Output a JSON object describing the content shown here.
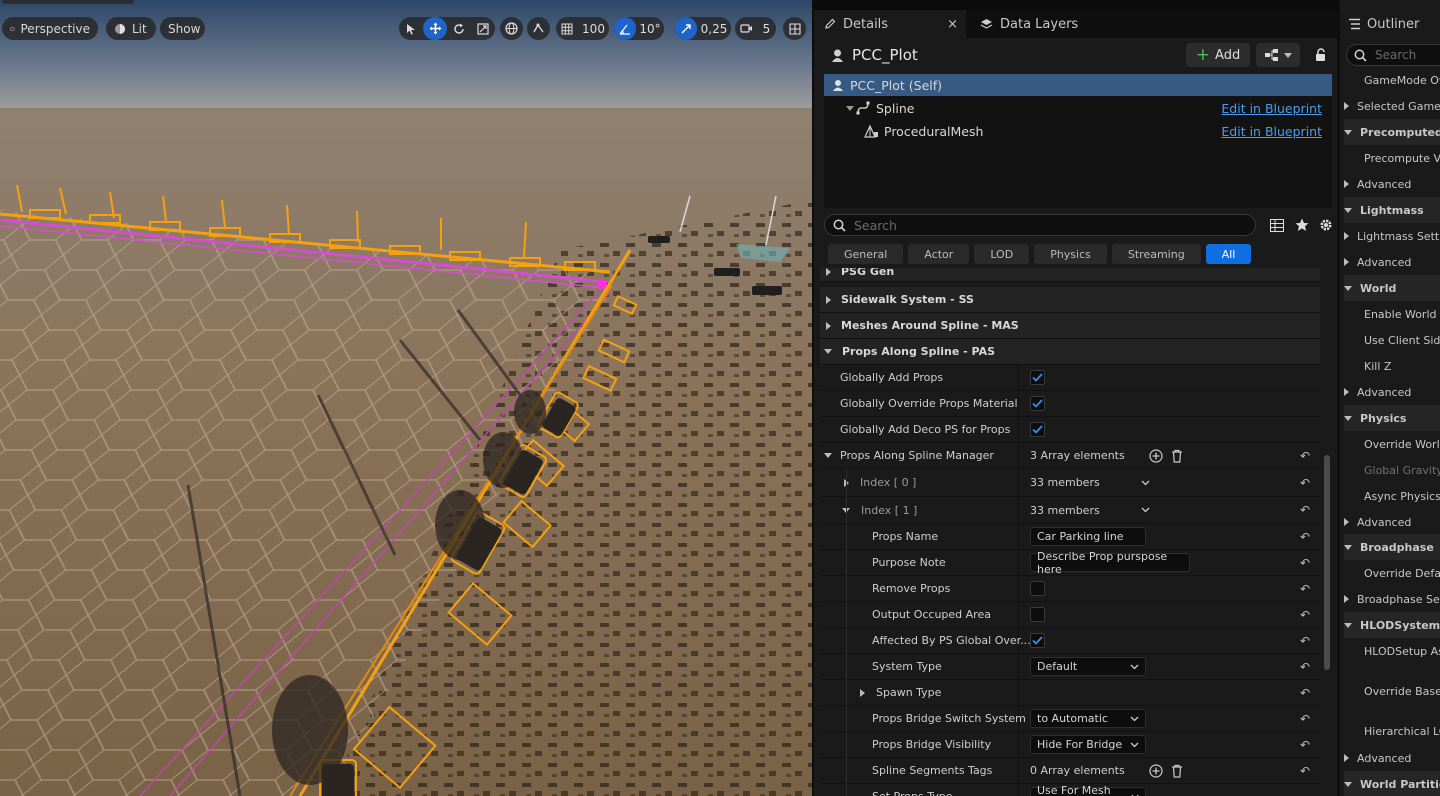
{
  "viewport": {
    "perspective_label": "Perspective",
    "lit_label": "Lit",
    "show_label": "Show",
    "grid_snap": "100",
    "rotation_snap": "10°",
    "scale_snap": "0,25",
    "camera_speed": "5"
  },
  "details": {
    "tab_details": "Details",
    "tab_data_layers": "Data Layers",
    "actor_name": "PCC_Plot",
    "add_label": "Add",
    "components": [
      {
        "label": "PCC_Plot (Self)",
        "link": ""
      },
      {
        "label": "Spline",
        "link": "Edit in Blueprint"
      },
      {
        "label": "ProceduralMesh",
        "link": "Edit in Blueprint"
      }
    ],
    "search_placeholder": "Search",
    "filters": [
      "General",
      "Actor",
      "LOD",
      "Physics",
      "Streaming",
      "All"
    ],
    "active_filter": "All",
    "categories": {
      "psg_gen": "PSG Gen",
      "sidewalk": "Sidewalk System - SS",
      "meshes_around": "Meshes Around Spline - MAS",
      "props_along": "Props Along Spline - PAS"
    },
    "props": {
      "globally_add_props": "Globally Add Props",
      "globally_override_material": "Globally Override Props Material",
      "globally_add_deco": "Globally Add Deco PS for Props",
      "manager": "Props Along Spline Manager",
      "manager_value": "3 Array elements",
      "index0": "Index [ 0 ]",
      "index0_value": "33 members",
      "index1": "Index [ 1 ]",
      "index1_value": "33 members",
      "props_name": "Props Name",
      "props_name_value": "Car Parking line",
      "purpose_note": "Purpose Note",
      "purpose_note_value": "Describe Prop purspose here",
      "remove_props": "Remove Props",
      "output_occuped": "Output Occuped Area",
      "affected_by": "Affected By PS Global Over...",
      "system_type": "System Type",
      "system_type_value": "Default",
      "spawn_type": "Spawn Type",
      "bridge_switch": "Props Bridge Switch System",
      "bridge_switch_value": "to Automatic",
      "bridge_visibility": "Props Bridge Visibility",
      "bridge_visibility_value": "Hide For Bridge",
      "segments_tags": "Spline Segments Tags",
      "segments_tags_value": "0 Array elements",
      "set_props_type": "Set Props Type",
      "set_props_type_value": "Use For Mesh Only"
    }
  },
  "outliner": {
    "title": "Outliner",
    "search_placeholder": "Search",
    "rows": [
      {
        "label": "GameMode Ove",
        "type": "item"
      },
      {
        "label": "Selected GameM",
        "type": "expand"
      },
      {
        "label": "Precomputed Vi",
        "type": "cat"
      },
      {
        "label": "Precompute Visi",
        "type": "item"
      },
      {
        "label": "Advanced",
        "type": "expand"
      },
      {
        "label": "Lightmass",
        "type": "cat"
      },
      {
        "label": "Lightmass Setti",
        "type": "expand"
      },
      {
        "label": "Advanced",
        "type": "expand"
      },
      {
        "label": "World",
        "type": "cat"
      },
      {
        "label": "Enable World Co",
        "type": "item"
      },
      {
        "label": "Use Client Side",
        "type": "item"
      },
      {
        "label": "Kill Z",
        "type": "item"
      },
      {
        "label": "Advanced",
        "type": "expand"
      },
      {
        "label": "Physics",
        "type": "cat"
      },
      {
        "label": "Override World G",
        "type": "item"
      },
      {
        "label": "Global Gravity Z",
        "type": "dim"
      },
      {
        "label": "Async Physics T",
        "type": "item"
      },
      {
        "label": "Advanced",
        "type": "expand"
      },
      {
        "label": "Broadphase",
        "type": "cat"
      },
      {
        "label": "Override Default",
        "type": "item"
      },
      {
        "label": "Broadphase Sett",
        "type": "expand"
      },
      {
        "label": "HLODSystem",
        "type": "cat"
      },
      {
        "label": "HLODSetup Ass",
        "type": "item"
      },
      {
        "label": "Override Base M",
        "type": "item"
      },
      {
        "label": "Hierarchical LOD",
        "type": "item"
      },
      {
        "label": "Advanced",
        "type": "expand"
      },
      {
        "label": "World Partition S",
        "type": "cat"
      }
    ]
  },
  "colors": {
    "accent": "#0f6fe0",
    "link": "#4a9cf0",
    "selection": "#365a84",
    "spline_orange": "#f5a10f",
    "spline_magenta": "#d44fd0"
  }
}
